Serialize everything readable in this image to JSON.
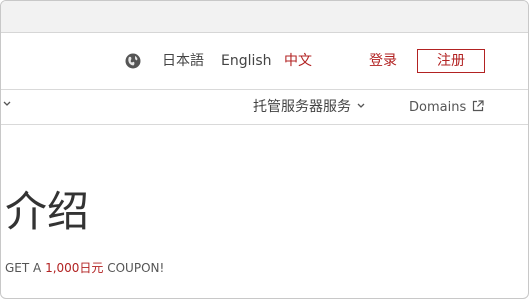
{
  "header": {
    "languages": [
      {
        "label": "日本語"
      },
      {
        "label": "English"
      },
      {
        "label": "中文"
      }
    ],
    "login_label": "登录",
    "register_label": "注册",
    "globe_icon": "globe-icon"
  },
  "nav": {
    "hosting_label": "托管服务器服务",
    "domains_label": "Domains",
    "external_icon": "external-link-icon"
  },
  "main": {
    "title": "介绍",
    "promo_prefix": "GET A ",
    "promo_amount": "1,000日元",
    "promo_suffix": " COUPON!"
  },
  "colors": {
    "accent": "#b22222",
    "text": "#333333",
    "topbar": "#f2f2f2"
  }
}
